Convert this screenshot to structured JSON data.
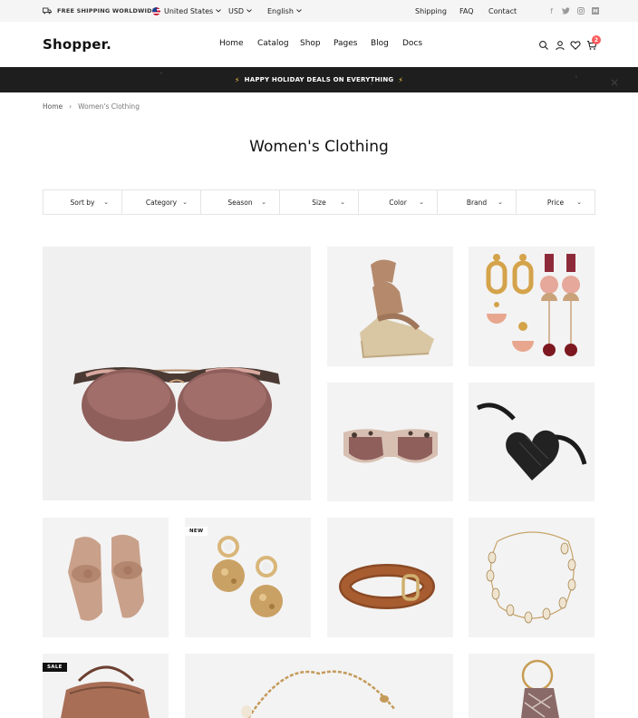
{
  "topbar": {
    "shipping_text": "FREE SHIPPING WORLDWIDE",
    "country": "United States",
    "currency": "USD",
    "language": "English",
    "links": [
      "Shipping",
      "FAQ",
      "Contact"
    ],
    "social_icons": [
      "facebook-icon",
      "twitter-icon",
      "instagram-icon",
      "medium-icon"
    ]
  },
  "header": {
    "logo": "Shopper.",
    "nav": [
      "Home",
      "Catalog",
      "Shop",
      "Pages",
      "Blog",
      "Docs"
    ],
    "icons": [
      "search-icon",
      "user-icon",
      "heart-icon",
      "cart-icon"
    ],
    "cart_count": "2"
  },
  "promo": {
    "text": "HAPPY HOLIDAY DEALS ON EVERYTHING"
  },
  "breadcrumb": {
    "home": "Home",
    "current": "Women's Clothing"
  },
  "page": {
    "title": "Women's Clothing"
  },
  "filters": [
    "Sort by",
    "Category",
    "Season",
    "Size",
    "Color",
    "Brand",
    "Price"
  ],
  "products": [
    {
      "name": "sunglasses-clubmaster"
    },
    {
      "name": "wedge-sandal"
    },
    {
      "name": "drop-earrings-set"
    },
    {
      "name": "sunglasses-tortoise"
    },
    {
      "name": "heart-belt-bag"
    },
    {
      "name": "knot-sandals"
    },
    {
      "name": "hammered-earrings",
      "badge": "NEW"
    },
    {
      "name": "leather-belt"
    },
    {
      "name": "shell-necklace"
    },
    {
      "name": "bucket-bag",
      "badge": "SALE"
    },
    {
      "name": "chain-necklace"
    },
    {
      "name": "ring-handle-bag"
    }
  ],
  "colors": {
    "accent": "#fa5c5c",
    "promo_bg": "#1e1e1e",
    "bolt": "#f6c84c",
    "tile_bg": "#f3f3f3"
  }
}
